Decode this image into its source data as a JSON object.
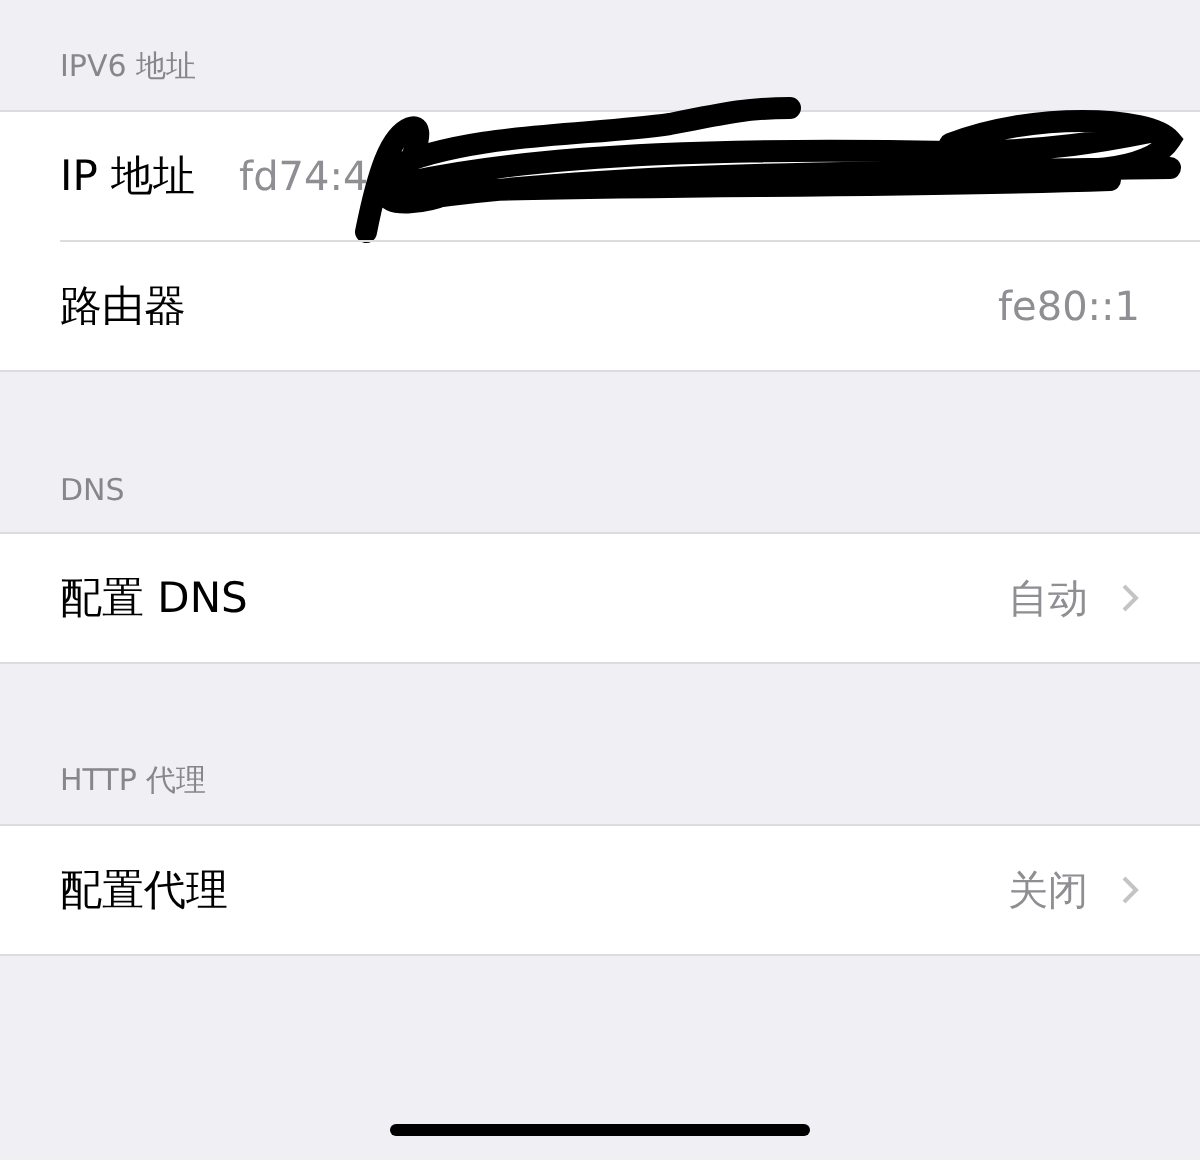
{
  "sections": [
    {
      "header": "IPV6 地址",
      "rows": [
        {
          "kind": "info",
          "label": "IP 地址",
          "value": "fd74:4",
          "redacted": true
        },
        {
          "kind": "info",
          "label": "路由器",
          "value": "fe80::1",
          "redacted": false
        }
      ]
    },
    {
      "header": "DNS",
      "rows": [
        {
          "kind": "disclosure",
          "label": "配置 DNS",
          "value": "自动",
          "redacted": false
        }
      ]
    },
    {
      "header": "HTTP 代理",
      "rows": [
        {
          "kind": "disclosure",
          "label": "配置代理",
          "value": "关闭",
          "redacted": false
        }
      ]
    }
  ]
}
